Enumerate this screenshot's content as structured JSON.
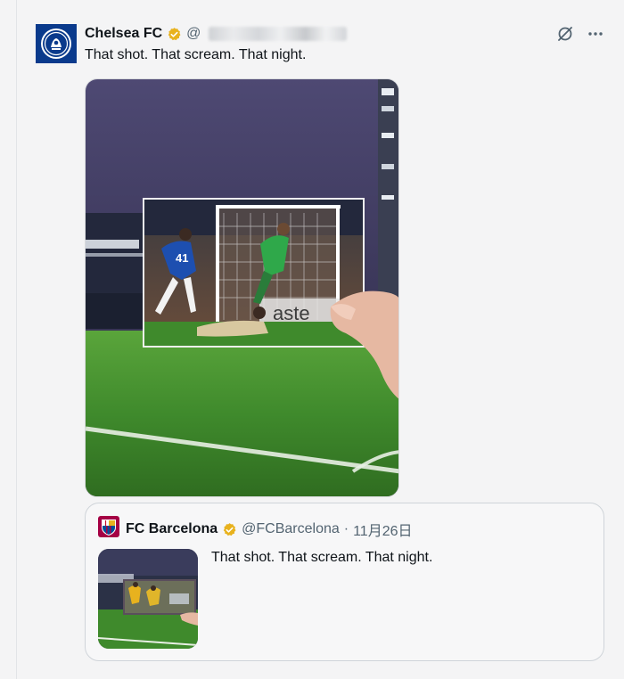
{
  "tweet": {
    "display_name": "Chelsea FC",
    "handle": "@",
    "text": "That shot. That scream. That night.",
    "avatar_icon": "chelsea-crest-icon",
    "verified_icon": "verified-badge-icon"
  },
  "actions": {
    "grok_icon": "grok-icon",
    "more_icon": "more-icon"
  },
  "media": {
    "photo_icon": "stadium-photo",
    "shirt_number": "41",
    "board_text": "aste"
  },
  "quote": {
    "display_name": "FC Barcelona",
    "handle": "@FCBarcelona",
    "dot": "·",
    "date": "11月26日",
    "text": "That shot. That scream. That night.",
    "avatar_icon": "barcelona-crest-icon"
  },
  "colors": {
    "chelsea_blue": "#0a3a8c",
    "verified_gold": "#e8b21e",
    "pitch_green": "#3f8a2c",
    "sky_purple": "#4e4973"
  }
}
